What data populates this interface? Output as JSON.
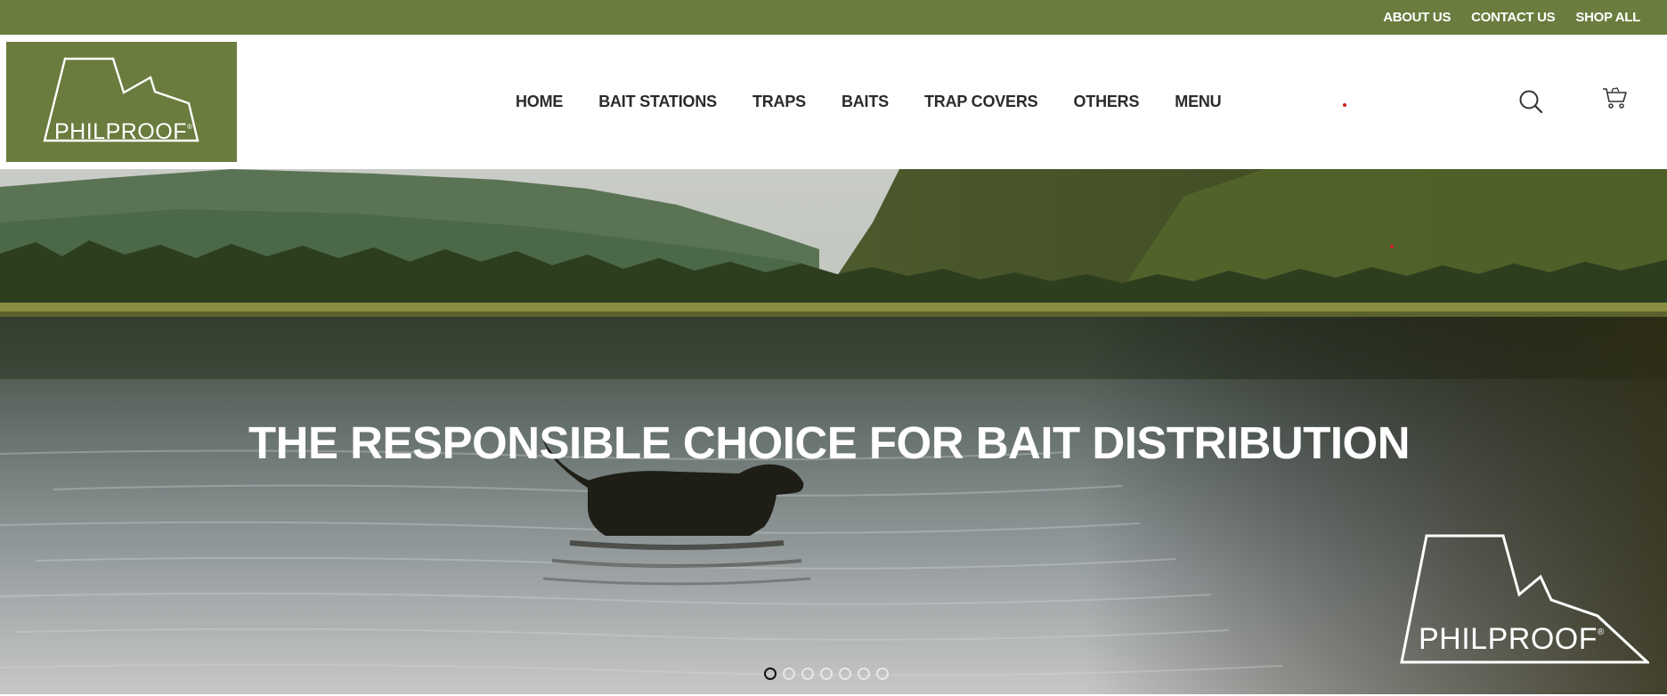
{
  "topbar": {
    "links": [
      "ABOUT US",
      "CONTACT US",
      "SHOP ALL"
    ],
    "background_color": "#6a7c3e"
  },
  "brand": {
    "logo_text": "PHILPROOF",
    "registered_mark": "®",
    "color": "#6a7c3e"
  },
  "nav": {
    "items": [
      "HOME",
      "BAIT STATIONS",
      "TRAPS",
      "BAITS",
      "TRAP COVERS",
      "OTHERS",
      "MENU"
    ]
  },
  "header_icons": {
    "search": "search-icon",
    "cart": "cart-icon"
  },
  "hero": {
    "title": "THE RESPONSIBLE CHOICE FOR BAIT DISTRIBUTION",
    "logo_text": "PHILPROOF",
    "registered_mark": "®",
    "slide_count": 7,
    "active_slide": 1
  }
}
